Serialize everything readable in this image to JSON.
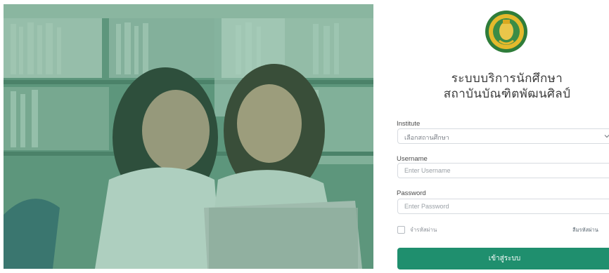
{
  "hero": {
    "image_alt": "students-with-laptop-photo"
  },
  "header": {
    "logo_icon": "ministry-seal-icon",
    "title_line1": "ระบบบริการนักศึกษา",
    "title_line2": "สถาบันบัณฑิตพัฒนศิลป์"
  },
  "form": {
    "institute": {
      "label": "Institute",
      "selected": "เลือกสถานศึกษา",
      "icon": "chevron-down-icon"
    },
    "username": {
      "label": "Username",
      "placeholder": "Enter Username",
      "value": ""
    },
    "password": {
      "label": "Password",
      "placeholder": "Enter Password",
      "value": ""
    },
    "remember_label": "จำรหัสผ่าน",
    "forgot_label": "ลืมรหัสผ่าน",
    "submit_label": "เข้าสู่ระบบ"
  },
  "colors": {
    "primary": "#1f8f6e",
    "hero_tint": "#3f8a68",
    "border": "#d7dbe0"
  }
}
